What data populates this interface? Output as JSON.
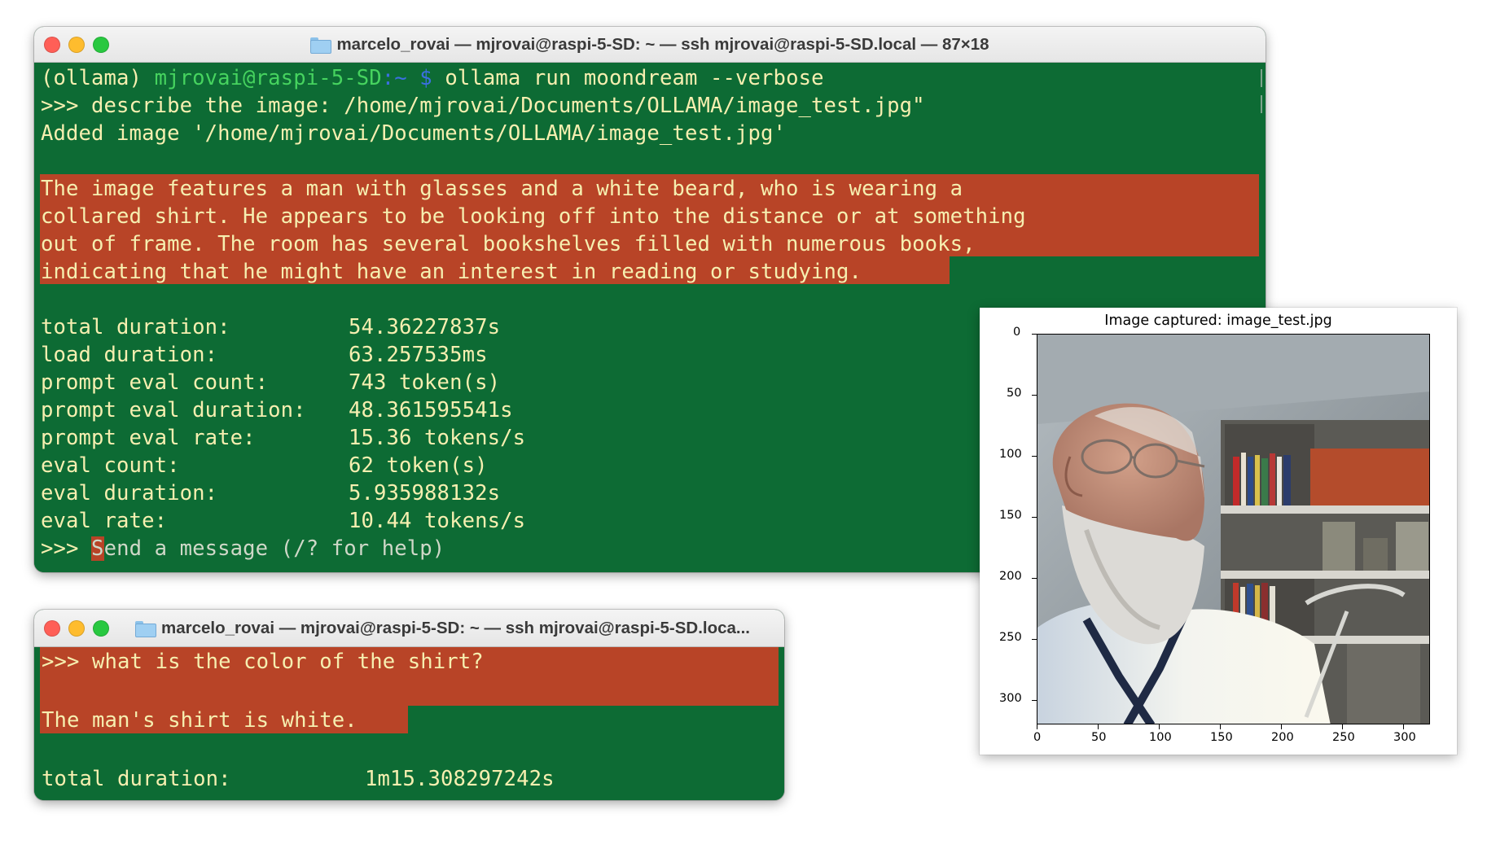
{
  "window_main": {
    "title": "marcelo_rovai — mjrovai@raspi-5-SD: ~ — ssh mjrovai@raspi-5-SD.local — 87×18",
    "prompt": {
      "env": "(ollama) ",
      "user_host": "mjrovai@raspi-5-SD",
      "path": ":~",
      "symbol": " $ ",
      "command": "ollama run moondream --verbose"
    },
    "lines": [
      ">>> describe the image: /home/mjrovai/Documents/OLLAMA/image_test.jpg\"",
      "Added image '/home/mjrovai/Documents/OLLAMA/image_test.jpg'"
    ],
    "response": [
      "The image features a man with glasses and a white beard, who is wearing a",
      "collared shirt. He appears to be looking off into the distance or at something",
      "out of frame. The room has several bookshelves filled with numerous books,",
      "indicating that he might have an interest in reading or studying."
    ],
    "stats": [
      {
        "label": "total duration:",
        "value": "54.36227837s"
      },
      {
        "label": "load duration:",
        "value": "63.257535ms"
      },
      {
        "label": "prompt eval count:",
        "value": "743 token(s)"
      },
      {
        "label": "prompt eval duration:",
        "value": "48.361595541s"
      },
      {
        "label": "prompt eval rate:",
        "value": "15.36 tokens/s"
      },
      {
        "label": "eval count:",
        "value": "62 token(s)"
      },
      {
        "label": "eval duration:",
        "value": "5.935988132s"
      },
      {
        "label": "eval rate:",
        "value": "10.44 tokens/s"
      }
    ],
    "input_prompt": ">>> ",
    "input_first_char": "S",
    "input_placeholder_rest": "end a message (/? for help)"
  },
  "window_second": {
    "title": "marcelo_rovai — mjrovai@raspi-5-SD: ~ — ssh mjrovai@raspi-5-SD.loca...",
    "question": ">>> what is the color of the shirt?",
    "answer": "The man's shirt is white.",
    "stat": {
      "label": "total duration:",
      "value": "1m15.308297242s"
    }
  },
  "figure": {
    "title": "Image captured: image_test.jpg",
    "x_ticks": [
      "0",
      "50",
      "100",
      "150",
      "200",
      "250",
      "300"
    ],
    "y_ticks": [
      "0",
      "50",
      "100",
      "150",
      "200",
      "250",
      "300"
    ]
  },
  "colors": {
    "terminal_bg": "#0d6b34",
    "terminal_text": "#f6efb0",
    "highlight": "#b84427",
    "prompt_green": "#46d35f",
    "prompt_blue": "#3b6fe0"
  }
}
